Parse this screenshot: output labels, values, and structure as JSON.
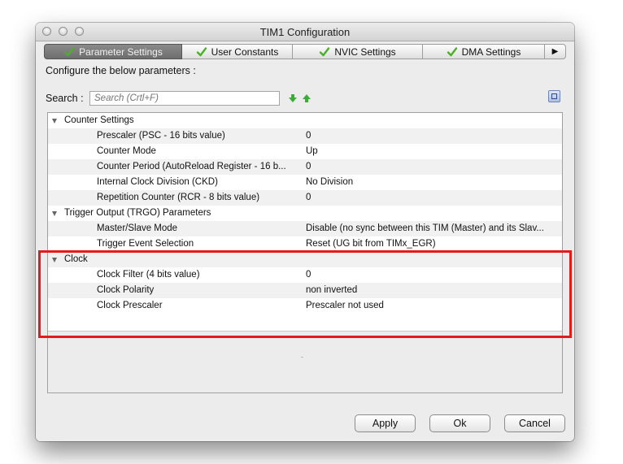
{
  "window": {
    "title": "TIM1 Configuration"
  },
  "tabs": [
    {
      "label": "Parameter Settings",
      "active": true
    },
    {
      "label": "User Constants",
      "active": false
    },
    {
      "label": "NVIC Settings",
      "active": false
    },
    {
      "label": "DMA Settings",
      "active": false
    }
  ],
  "tabs_more_glyph": "▶",
  "configure_text": "Configure the below parameters :",
  "search": {
    "label": "Search :",
    "placeholder": "Search (Crtl+F)"
  },
  "tree": {
    "categories": [
      {
        "label": "Counter Settings",
        "params": [
          {
            "name": "Prescaler (PSC - 16 bits value)",
            "value": "0"
          },
          {
            "name": "Counter Mode",
            "value": "Up"
          },
          {
            "name": "Counter Period (AutoReload Register - 16 b...",
            "value": "0"
          },
          {
            "name": "Internal Clock Division (CKD)",
            "value": "No Division"
          },
          {
            "name": "Repetition Counter (RCR - 8 bits value)",
            "value": "0"
          }
        ]
      },
      {
        "label": "Trigger Output (TRGO) Parameters",
        "params": [
          {
            "name": "Master/Slave Mode",
            "value": "Disable (no sync between this TIM (Master) and its Slav..."
          },
          {
            "name": "Trigger Event Selection",
            "value": "Reset (UG bit from TIMx_EGR)"
          }
        ]
      },
      {
        "label": "Clock",
        "params": [
          {
            "name": "Clock Filter (4 bits value)",
            "value": "0"
          },
          {
            "name": "Clock Polarity",
            "value": "non inverted"
          },
          {
            "name": "Clock Prescaler",
            "value": "Prescaler not used"
          }
        ]
      }
    ]
  },
  "buttons": {
    "apply": "Apply",
    "ok": "Ok",
    "cancel": "Cancel"
  },
  "colors": {
    "highlight": "#e31b1b",
    "check_green": "#4caf2a",
    "arrow_green": "#3cab3a"
  }
}
